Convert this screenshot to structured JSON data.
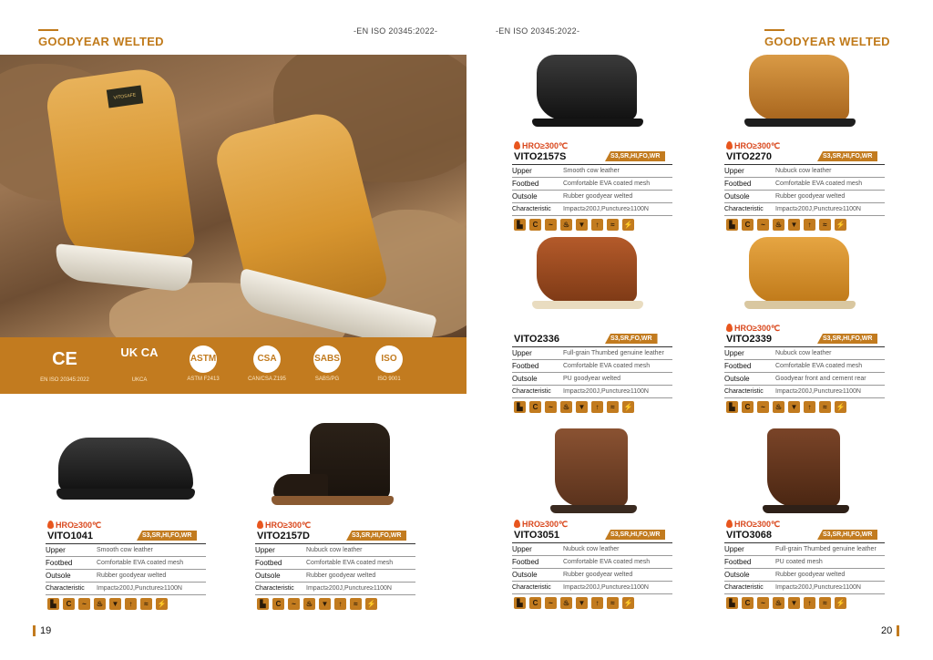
{
  "left": {
    "title": "GOODYEAR WELTED",
    "standard": "-EN ISO 20345:2022-",
    "page_number": "19",
    "hero_logo_text": "VITOSAFE",
    "certs": [
      {
        "symbol": "CE",
        "caption": "EN ISO 20345:2022"
      },
      {
        "symbol": "UK CA",
        "caption": "UKCA"
      },
      {
        "symbol": "ASTM",
        "caption": "ASTM F2413"
      },
      {
        "symbol": "CSA",
        "caption": "CAN/CSA Z195"
      },
      {
        "symbol": "SABS",
        "caption": "SABS/PG"
      },
      {
        "symbol": "ISO",
        "caption": "ISO 9001"
      }
    ],
    "products": [
      {
        "hro": "HRO≥300℃",
        "code": "VITO1041",
        "badge": "S3,SR,HI,FO,WR",
        "upper": "Smooth cow leather",
        "footbed": "Comfortable EVA coated mesh",
        "outsole": "Rubber goodyear welted",
        "characteristic": "Impact≥200J,Puncture≥1100N"
      },
      {
        "hro": "HRO≥300℃",
        "code": "VITO2157D",
        "badge": "S3,SR,HI,FO,WR",
        "upper": "Nubuck cow leather",
        "footbed": "Comfortable EVA coated mesh",
        "outsole": "Rubber goodyear welted",
        "characteristic": "Impact≥200J,Puncture≥1100N"
      }
    ]
  },
  "right": {
    "title": "GOODYEAR WELTED",
    "standard": "-EN ISO 20345:2022-",
    "page_number": "20",
    "products": [
      {
        "hro": "HRO≥300℃",
        "code": "VITO2157S",
        "badge": "S3,SR,HI,FO,WR",
        "upper": "Smooth cow leather",
        "footbed": "Comfortable EVA coated mesh",
        "outsole": "Rubber goodyear welted",
        "characteristic": "Impact≥200J,Puncture≥1100N"
      },
      {
        "hro": "HRO≥300℃",
        "code": "VITO2270",
        "badge": "S3,SR,HI,FO,WR",
        "upper": "Nubuck cow leather",
        "footbed": "Comfortable EVA coated mesh",
        "outsole": "Rubber goodyear welted",
        "characteristic": "Impact≥200J,Puncture≥1100N"
      },
      {
        "hro": "",
        "code": "VITO2336",
        "badge": "S3,SR,FO,WR",
        "upper": "Full-grain Thumbed genuine leather",
        "footbed": "Comfortable EVA coated mesh",
        "outsole": "PU goodyear welted",
        "characteristic": "Impact≥200J,Puncture≥1100N"
      },
      {
        "hro": "HRO≥300℃",
        "code": "VITO2339",
        "badge": "S3,SR,HI,FO,WR",
        "upper": "Nubuck cow leather",
        "footbed": "Comfortable EVA coated mesh",
        "outsole": "Goodyear front and cement rear",
        "characteristic": "Impact≥200J,Puncture≥1100N"
      },
      {
        "hro": "HRO≥300℃",
        "code": "VITO3051",
        "badge": "S3,SR,HI,FO,WR",
        "upper": "Nubuck cow leather",
        "footbed": "Comfortable EVA coated mesh",
        "outsole": "Rubber goodyear welted",
        "characteristic": "Impact≥200J,Puncture≥1100N"
      },
      {
        "hro": "HRO≥300℃",
        "code": "VITO3068",
        "badge": "S3,SR,HI,FO,WR",
        "upper": "Full-grain Thumbed genuine leather",
        "footbed": "PU coated mesh",
        "outsole": "Rubber goodyear welted",
        "characteristic": "Impact≥200J,Puncture≥1100N"
      }
    ]
  },
  "row_labels": {
    "upper": "Upper",
    "footbed": "Footbed",
    "outsole": "Outsole",
    "characteristic": "Characteristic"
  },
  "feature_icons": [
    "boot-icon",
    "ce-icon",
    "slip-resistant-icon",
    "heat-resistant-icon",
    "impact-icon",
    "puncture-icon",
    "water-resistant-icon",
    "electrostatic-icon"
  ],
  "colors": {
    "accent": "#c27b1f",
    "hro": "#d9471c"
  }
}
